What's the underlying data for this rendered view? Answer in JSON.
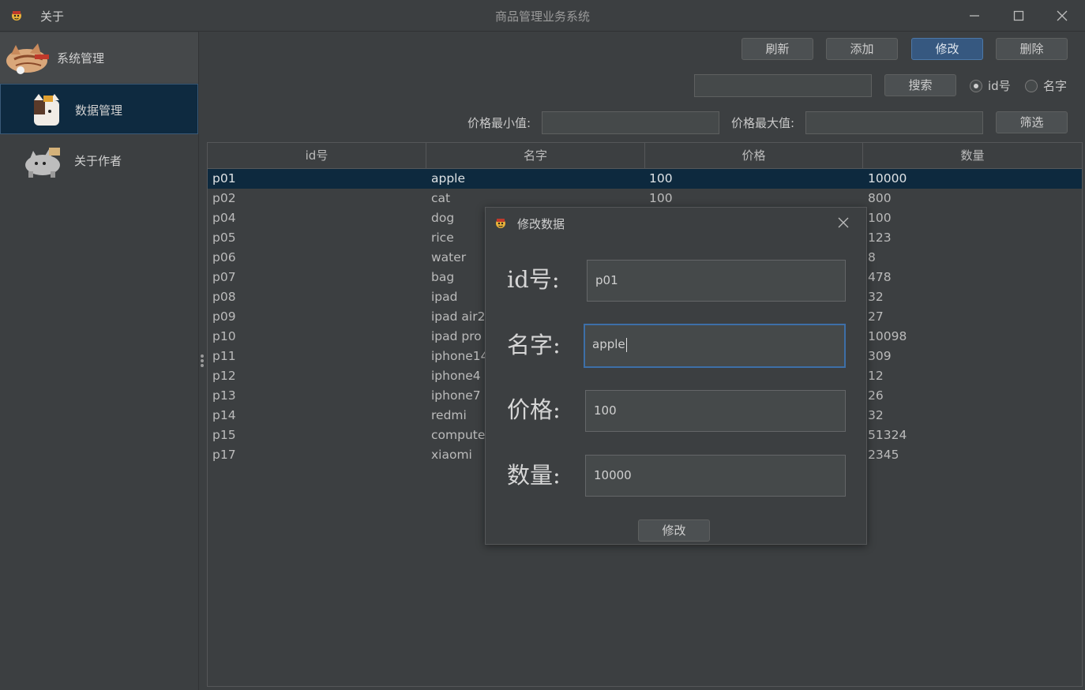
{
  "window": {
    "menu_about": "关于",
    "title": "商品管理业务系统"
  },
  "sidebar": {
    "items": [
      {
        "label": "系统管理"
      },
      {
        "label": "数据管理"
      },
      {
        "label": "关于作者"
      }
    ]
  },
  "toolbar": {
    "refresh": "刷新",
    "add": "添加",
    "modify": "修改",
    "delete": "删除"
  },
  "search": {
    "value": "",
    "button": "搜索",
    "radio_id_label": "id号",
    "radio_name_label": "名字",
    "selected": "id号"
  },
  "filter": {
    "min_label": "价格最小值:",
    "min_value": "",
    "max_label": "价格最大值:",
    "max_value": "",
    "button": "筛选"
  },
  "table": {
    "columns": [
      "id号",
      "名字",
      "价格",
      "数量"
    ],
    "rows": [
      [
        "p01",
        "apple",
        "100",
        "10000"
      ],
      [
        "p02",
        "cat",
        "100",
        "800"
      ],
      [
        "p04",
        "dog",
        "",
        "100"
      ],
      [
        "p05",
        "rice",
        "",
        "123"
      ],
      [
        "p06",
        "water",
        "",
        "8"
      ],
      [
        "p07",
        "bag",
        "",
        "478"
      ],
      [
        "p08",
        "ipad",
        "",
        "32"
      ],
      [
        "p09",
        "ipad air2",
        "",
        "27"
      ],
      [
        "p10",
        "ipad pro",
        "",
        "10098"
      ],
      [
        "p11",
        "iphone14",
        "",
        "309"
      ],
      [
        "p12",
        "iphone4",
        "",
        "12"
      ],
      [
        "p13",
        "iphone7",
        "",
        "26"
      ],
      [
        "p14",
        "redmi",
        "",
        "32"
      ],
      [
        "p15",
        "computer",
        "",
        "51324"
      ],
      [
        "p17",
        "xiaomi",
        "",
        "2345"
      ]
    ],
    "selected_row": 0
  },
  "dialog": {
    "title": "修改数据",
    "fields": [
      {
        "label": "id号:",
        "value": "p01"
      },
      {
        "label": "名字:",
        "value": "apple"
      },
      {
        "label": "价格:",
        "value": "100"
      },
      {
        "label": "数量:",
        "value": "10000"
      }
    ],
    "submit": "修改"
  },
  "colors": {
    "background": "#3c3f41",
    "selection": "#0d293e",
    "primary_button": "#365880",
    "focus_border": "#3d6fa8"
  },
  "icons": [
    "app-icon",
    "minimize-icon",
    "maximize-icon",
    "close-icon",
    "cat-sticker-icon"
  ]
}
